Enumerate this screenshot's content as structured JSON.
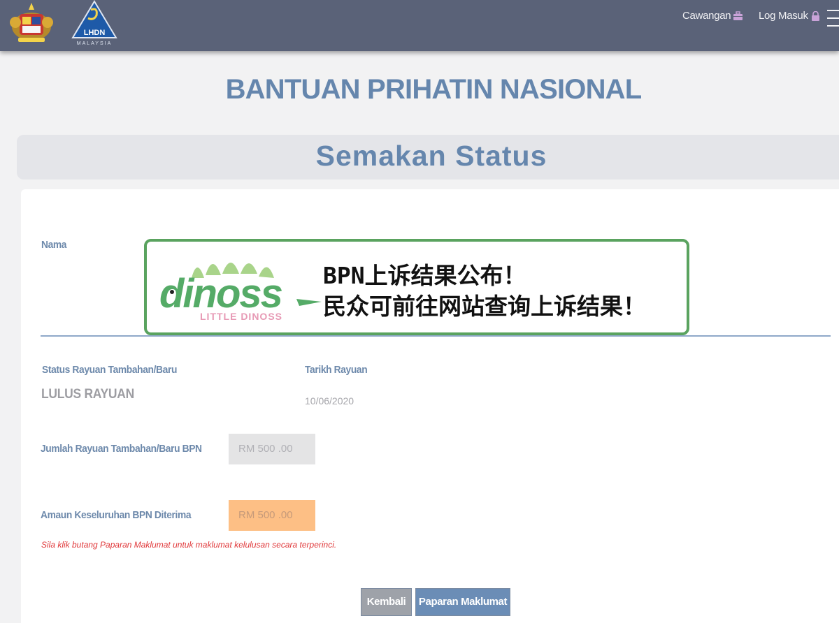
{
  "header": {
    "lhdn_logo_text": "LHDN",
    "lhdn_logo_subtext": "MALAYSIA",
    "nav": {
      "cawangan": "Cawangan",
      "log_masuk": "Log Masuk"
    }
  },
  "page": {
    "title": "BANTUAN PRIHATIN NASIONAL",
    "subtitle": "Semakan Status"
  },
  "form": {
    "nama_label": "Nama",
    "status_label": "Status Rayuan Tambahan/Baru",
    "status_value": "LULUS RAYUAN",
    "tarikh_label": "Tarikh Rayuan",
    "tarikh_value": "10/06/2020",
    "jumlah_label": "Jumlah Rayuan Tambahan/Baru BPN",
    "jumlah_value": "RM 500 .00",
    "amaun_label": "Amaun Keseluruhan BPN Diterima",
    "amaun_value": "RM 500 .00",
    "note": "Sila klik butang Paparan Maklumat untuk maklumat kelulusan secara terperinci.",
    "buttons": {
      "back": "Kembali",
      "detail": "Paparan Maklumat"
    }
  },
  "banner": {
    "logo_text": "dinoss",
    "logo_subtext": "LITTLE DINOSS",
    "line1": "BPN上诉结果公布！",
    "line2": "民众可前往网站查询上诉结果！"
  },
  "colors": {
    "header_bg": "#5a6278",
    "title_blue": "#6586ad",
    "banner_green": "#5aa35f",
    "note_red": "#e0383a",
    "amount_orange": "#fdbf85"
  }
}
